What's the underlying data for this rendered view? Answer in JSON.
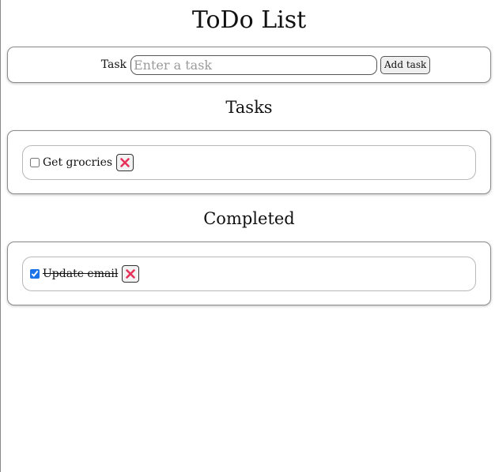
{
  "app": {
    "title": "ToDo List"
  },
  "form": {
    "label": "Task",
    "input_value": "",
    "input_placeholder": "Enter a task",
    "add_button_label": "Add task"
  },
  "tasks": {
    "heading": "Tasks",
    "items": [
      {
        "text": "Get grocries",
        "checked": false,
        "delete_icon": "close-x-icon"
      }
    ]
  },
  "completed": {
    "heading": "Completed",
    "items": [
      {
        "text": "Update email",
        "checked": true,
        "delete_icon": "close-x-icon"
      }
    ]
  },
  "colors": {
    "delete_x": "#e8315a",
    "checkbox_accent": "#1a73e8"
  }
}
